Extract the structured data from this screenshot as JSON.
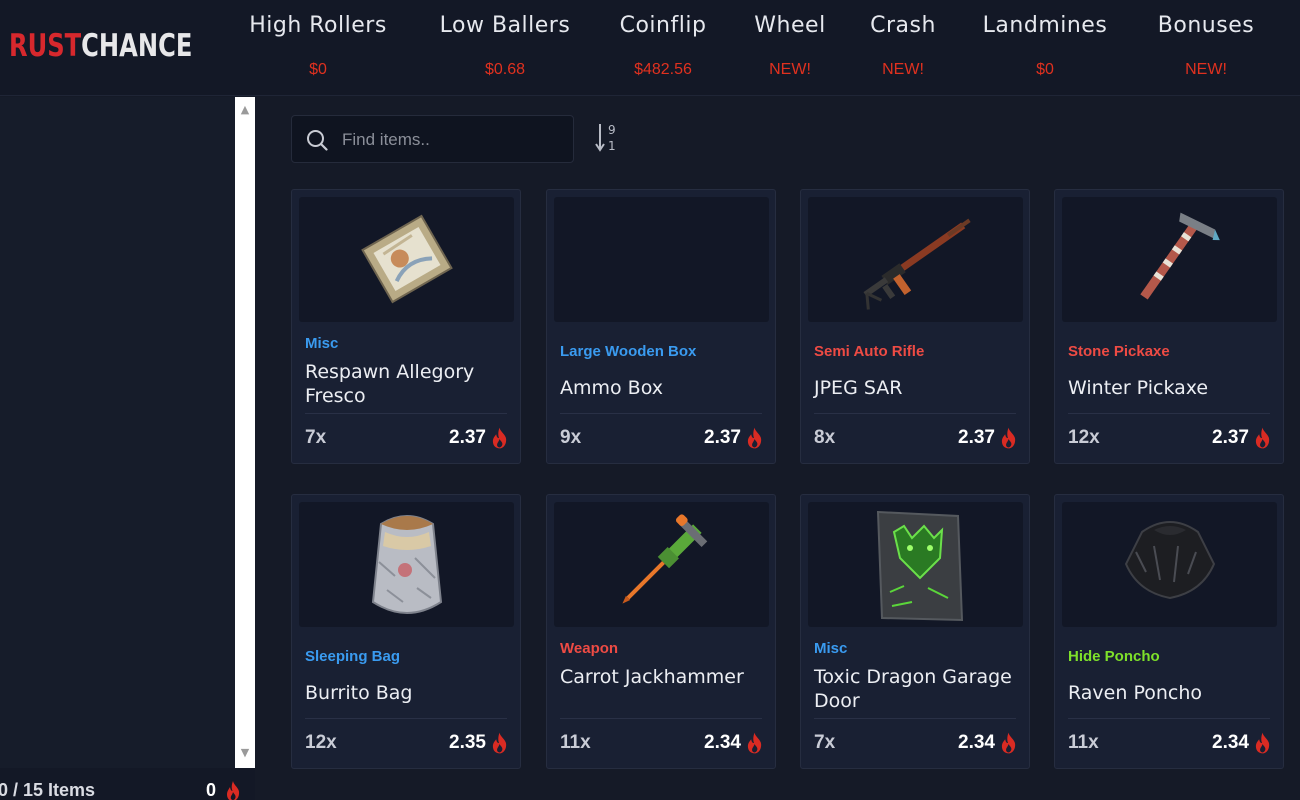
{
  "logo": {
    "part1": "R",
    "part2": "ST",
    "part3": "CHANCE",
    "flame_letter": "U"
  },
  "nav": [
    {
      "label": "High Rollers",
      "sub": "$0"
    },
    {
      "label": "Low Ballers",
      "sub": "$0.68"
    },
    {
      "label": "Coinflip",
      "sub": "$482.56"
    },
    {
      "label": "Wheel",
      "sub": "NEW!"
    },
    {
      "label": "Crash",
      "sub": "NEW!"
    },
    {
      "label": "Landmines",
      "sub": "$0"
    },
    {
      "label": "Bonuses",
      "sub": "NEW!"
    }
  ],
  "sidebar": {
    "items_count": "0 / 15 Items",
    "total": "0"
  },
  "search": {
    "placeholder": "Find items.."
  },
  "sort": {
    "icon": "sort-numeric-desc-icon",
    "top": "9",
    "bottom": "1"
  },
  "colors": {
    "accent": "#e0311f",
    "blue_cat": "#3a9bf0",
    "red_cat": "#ee4b44",
    "green_cat": "#7ee02a"
  },
  "items": [
    {
      "category": "Misc",
      "cat_color": "#3a9bf0",
      "name": "Respawn Allegory Fresco",
      "qty": "7x",
      "price": "2.37",
      "icon": "fresco-painting-icon"
    },
    {
      "category": "Large Wooden Box",
      "cat_color": "#3a9bf0",
      "name": "Ammo Box",
      "qty": "9x",
      "price": "2.37",
      "icon": "ammo-box-icon"
    },
    {
      "category": "Semi Auto Rifle",
      "cat_color": "#ee4b44",
      "name": "JPEG SAR",
      "qty": "8x",
      "price": "2.37",
      "icon": "rifle-icon"
    },
    {
      "category": "Stone Pickaxe",
      "cat_color": "#ee4b44",
      "name": "Winter Pickaxe",
      "qty": "12x",
      "price": "2.37",
      "icon": "pickaxe-icon"
    },
    {
      "category": "Sleeping Bag",
      "cat_color": "#3a9bf0",
      "name": "Burrito Bag",
      "qty": "12x",
      "price": "2.35",
      "icon": "sleeping-bag-icon"
    },
    {
      "category": "Weapon",
      "cat_color": "#ee4b44",
      "name": "Carrot Jackhammer",
      "qty": "11x",
      "price": "2.34",
      "icon": "jackhammer-icon"
    },
    {
      "category": "Misc",
      "cat_color": "#3a9bf0",
      "name": "Toxic Dragon Garage Door",
      "qty": "7x",
      "price": "2.34",
      "icon": "garage-door-icon"
    },
    {
      "category": "Hide Poncho",
      "cat_color": "#7ee02a",
      "name": "Raven Poncho",
      "qty": "11x",
      "price": "2.34",
      "icon": "poncho-icon"
    }
  ]
}
